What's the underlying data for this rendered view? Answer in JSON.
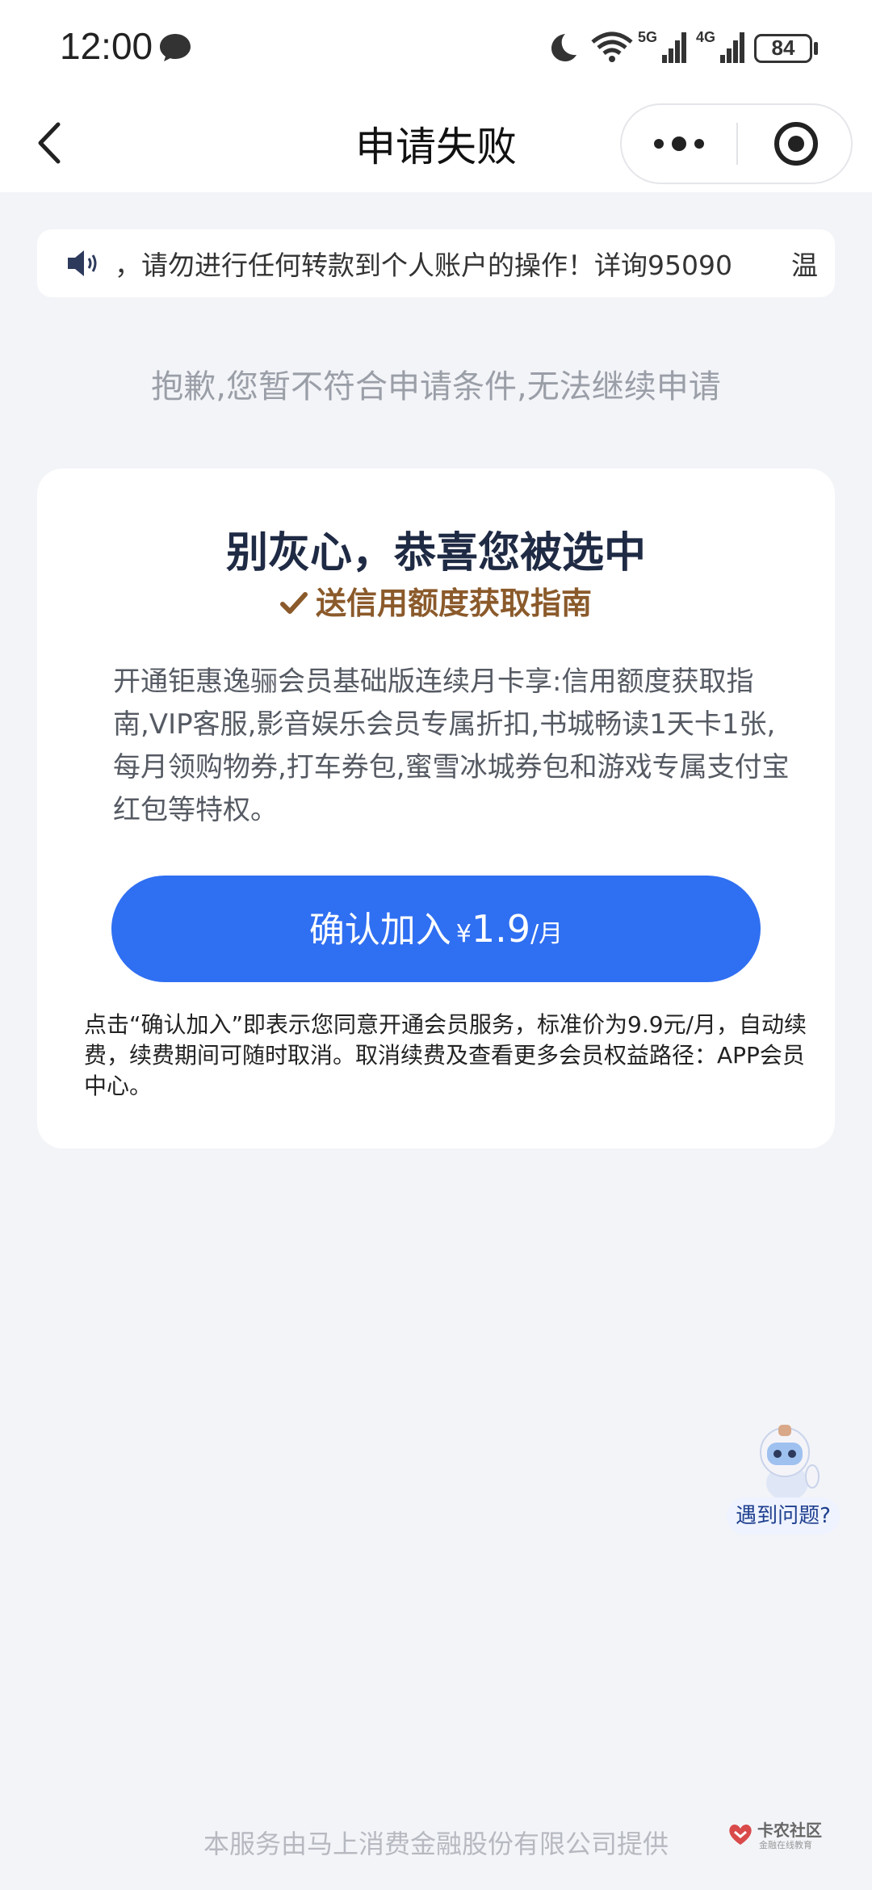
{
  "status_bar": {
    "time": "12:00",
    "network_5g": "5G",
    "network_4g": "4G",
    "battery": "84",
    "icons": [
      "chat-icon",
      "moon-icon",
      "wifi-icon",
      "signal-icon",
      "battery-icon"
    ]
  },
  "nav": {
    "title": "申请失败",
    "back_icon": "chevron-left-icon",
    "more_icon": "more-dots-icon",
    "close_icon": "target-close-icon"
  },
  "notice": {
    "icon": "speaker-icon",
    "text": "，请勿进行任何转款到个人账户的操作！详询95090",
    "text_next": "温"
  },
  "sorry_text": "抱歉,您暂不符合申请条件,无法继续申请",
  "card": {
    "title": "别灰心，恭喜您被选中",
    "subtitle": "送信用额度获取指南",
    "subtitle_icon": "check-icon",
    "benefits": "开通钜惠逸骊会员基础版连续月卡享:信用额度获取指南,VIP客服,影音娱乐会员专属折扣,书城畅读1天卡1张,每月领购物券,打车券包,蜜雪冰城券包和游戏专属支付宝红包等特权。",
    "button": {
      "label": "确认加入",
      "currency": "¥",
      "amount": "1.9",
      "unit": "/月"
    },
    "terms": "点击“确认加入”即表示您同意开通会员服务，标准价为9.9元/月，自动续费，续费期间可随时取消。取消续费及查看更多会员权益路径：APP会员中心。"
  },
  "help": {
    "label": "遇到问题?",
    "icon": "mascot-icon"
  },
  "footer": "本服务由马上消费金融股份有限公司提供",
  "watermark": {
    "title": "卡农社区",
    "subtitle": "金融在线教育"
  },
  "colors": {
    "primary": "#2f6ff2",
    "background": "#f3f4f8",
    "subtitle": "#8b5a2b",
    "title": "#1f2a44"
  }
}
